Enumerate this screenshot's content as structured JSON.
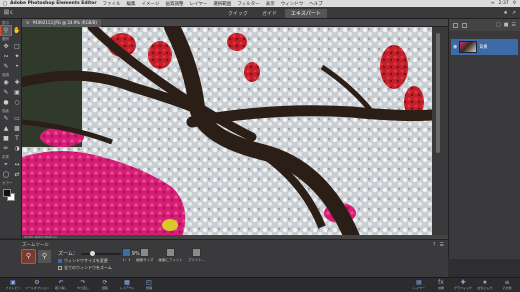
{
  "menubar": {
    "app_name": "Adobe Photoshop Elements Editor",
    "items": [
      "ファイル",
      "編集",
      "イメージ",
      "画質調整",
      "レイヤー",
      "選択範囲",
      "フィルター",
      "表示",
      "ウィンドウ",
      "ヘルプ"
    ],
    "clock": "2:37"
  },
  "modebar": {
    "open_label": "開く",
    "modes": [
      "クイック",
      "ガイド",
      "エキスパート"
    ],
    "active_mode": "エキスパート"
  },
  "toolbox": {
    "sections": [
      "表示",
      "選択",
      "強調",
      "描画",
      "変更",
      "カラー"
    ]
  },
  "document": {
    "tab_title": "P4092113.JPG @ 24.9% (RGB/8)",
    "status": "24.9% 4000×3000 px",
    "canvas_colors": {
      "sky": "#d8dde2",
      "branch": "#2b2118",
      "pink": "#e0227a",
      "red": "#c8242c",
      "blossom_white": "#eef0f2"
    }
  },
  "layers_panel": {
    "layer_name": "背景"
  },
  "tool_options": {
    "title": "ズームツール",
    "zoom_label": "ズーム：",
    "zoom_value": "24.9%",
    "check_resize": "ウィンドウサイズを変更",
    "check_all_windows": "全てのウィンドウをズーム",
    "view_buttons": [
      "1：1",
      "画面サイズ",
      "画面にフィット",
      "プリント..."
    ]
  },
  "taskbar": {
    "left": [
      "フォトビン",
      "ツールオプション",
      "取り消し",
      "やり直し",
      "回転",
      "レイアウト",
      "整理"
    ],
    "right": [
      "レイヤー",
      "効果",
      "グラフィック",
      "お気に入り",
      "その他"
    ]
  }
}
